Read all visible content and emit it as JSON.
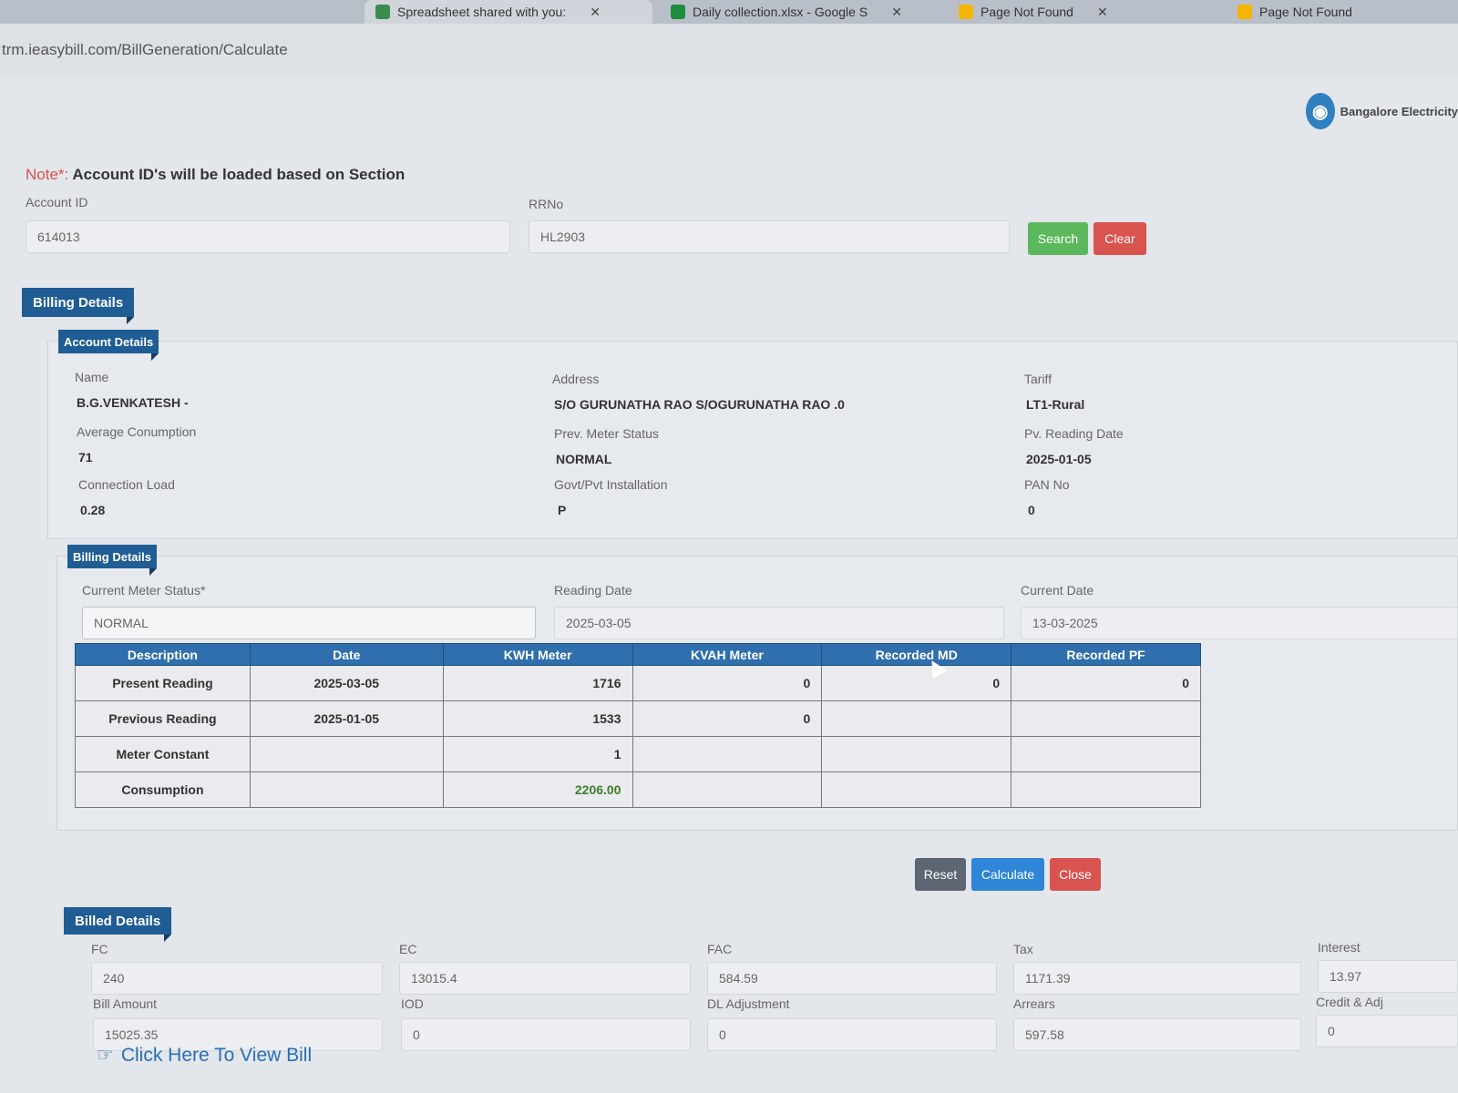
{
  "browser": {
    "tabs": [
      {
        "label": "Spreadsheet shared with you:"
      },
      {
        "label": "Daily collection.xlsx - Google S"
      },
      {
        "label": "Page Not Found"
      },
      {
        "label": "Page Not Found"
      }
    ],
    "url": "trm.ieasybill.com/BillGeneration/Calculate"
  },
  "header": {
    "brand": "Bangalore Electricity"
  },
  "note": {
    "prefix": "Note*:",
    "text": "Account ID's will be loaded based on Section"
  },
  "search": {
    "account_id_label": "Account ID",
    "account_id_value": "614013",
    "rrno_label": "RRNo",
    "rrno_value": "HL2903",
    "search_label": "Search",
    "clear_label": "Clear"
  },
  "billing_section_title": "Billing Details",
  "account_details": {
    "title": "Account Details",
    "name_label": "Name",
    "name_value": "B.G.VENKATESH -",
    "address_label": "Address",
    "address_value": "S/O  GURUNATHA RAO  S/OGURUNATHA RAO  .0",
    "tariff_label": "Tariff",
    "tariff_value": "LT1-Rural",
    "avg_consumption_label": "Average Conumption",
    "avg_consumption_value": "71",
    "prev_meter_status_label": "Prev. Meter Status",
    "prev_meter_status_value": "NORMAL",
    "prev_reading_date_label": "Pv. Reading Date",
    "prev_reading_date_value": "2025-01-05",
    "connection_load_label": "Connection Load",
    "connection_load_value": "0.28",
    "installation_label": "Govt/Pvt Installation",
    "installation_value": "P",
    "pan_label": "PAN No",
    "pan_value": "0"
  },
  "billing_details": {
    "title": "Billing Details",
    "meter_status_label": "Current Meter Status*",
    "meter_status_value": "NORMAL",
    "reading_date_label": "Reading Date",
    "reading_date_value": "2025-03-05",
    "current_date_label": "Current Date",
    "current_date_value": "13-03-2025",
    "columns": [
      "Description",
      "Date",
      "KWH Meter",
      "KVAH Meter",
      "Recorded MD",
      "Recorded PF"
    ],
    "rows": [
      {
        "desc": "Present Reading",
        "date": "2025-03-05",
        "kwh": "1716",
        "kvah": "0",
        "md": "0",
        "pf": "0"
      },
      {
        "desc": "Previous Reading",
        "date": "2025-01-05",
        "kwh": "1533",
        "kvah": "0",
        "md": "",
        "pf": ""
      },
      {
        "desc": "Meter Constant",
        "date": "",
        "kwh": "1",
        "kvah": "",
        "md": "",
        "pf": ""
      },
      {
        "desc": "Consumption",
        "date": "",
        "kwh": "2206.00",
        "kvah": "",
        "md": "",
        "pf": ""
      }
    ]
  },
  "actions": {
    "reset_label": "Reset",
    "calculate_label": "Calculate",
    "close_label": "Close"
  },
  "billed_details": {
    "title": "Billed Details",
    "fc_label": "FC",
    "fc_value": "240",
    "ec_label": "EC",
    "ec_value": "13015.4",
    "fac_label": "FAC",
    "fac_value": "584.59",
    "tax_label": "Tax",
    "tax_value": "1171.39",
    "interest_label": "Interest",
    "interest_value": "13.97",
    "bill_amount_label": "Bill Amount",
    "bill_amount_value": "15025.35",
    "iod_label": "IOD",
    "iod_value": "0",
    "dl_adjustment_label": "DL Adjustment",
    "dl_adjustment_value": "0",
    "arrears_label": "Arrears",
    "arrears_value": "597.58",
    "credit_adj_label": "Credit & Adj",
    "credit_adj_value": "0"
  },
  "view_bill_link": "Click Here To View Bill"
}
